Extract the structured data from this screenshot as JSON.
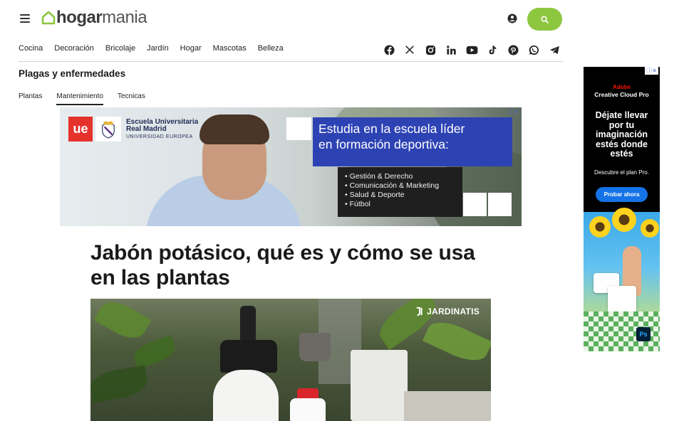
{
  "site": {
    "logo_part1": "hogar",
    "logo_part2": "mania",
    "brand_color": "#8dc63f"
  },
  "nav": {
    "items": [
      "Cocina",
      "Decoración",
      "Bricolaje",
      "Jardín",
      "Hogar",
      "Mascotas",
      "Belleza"
    ]
  },
  "social": {
    "icons": [
      "facebook-icon",
      "x-icon",
      "instagram-icon",
      "linkedin-icon",
      "youtube-icon",
      "tiktok-icon",
      "pinterest-icon",
      "whatsapp-icon",
      "telegram-icon"
    ]
  },
  "section": {
    "title": "Plagas y enfermedades"
  },
  "subnav": {
    "items": [
      "Plantas",
      "Mantenimiento",
      "Tecnicas"
    ],
    "active": "Mantenimiento"
  },
  "banner_ad": {
    "logo_ue": "ue",
    "school_line1": "Escuela Universitaria",
    "school_line2": "Real Madrid",
    "school_line3": "UNIVERSIDAD EUROPEA",
    "headline_line1": "Estudia en la escuela líder",
    "headline_line2": "en formación deportiva:",
    "list": [
      "Gestión & Derecho",
      "Comunicación & Marketing",
      "Salud & Deporte",
      "Fútbol"
    ]
  },
  "article": {
    "title": "Jabón potásico, qué es y cómo se usa en las plantas"
  },
  "hero": {
    "watermark": "JARDINATIS"
  },
  "side_ad": {
    "brand": "Adobe",
    "product": "Creative Cloud Pro",
    "headline": "Déjate llevar por tu imaginación estés donde estés",
    "sub": "Descubre el plan Pro.",
    "cta": "Probar ahora",
    "badge": "Ps"
  }
}
